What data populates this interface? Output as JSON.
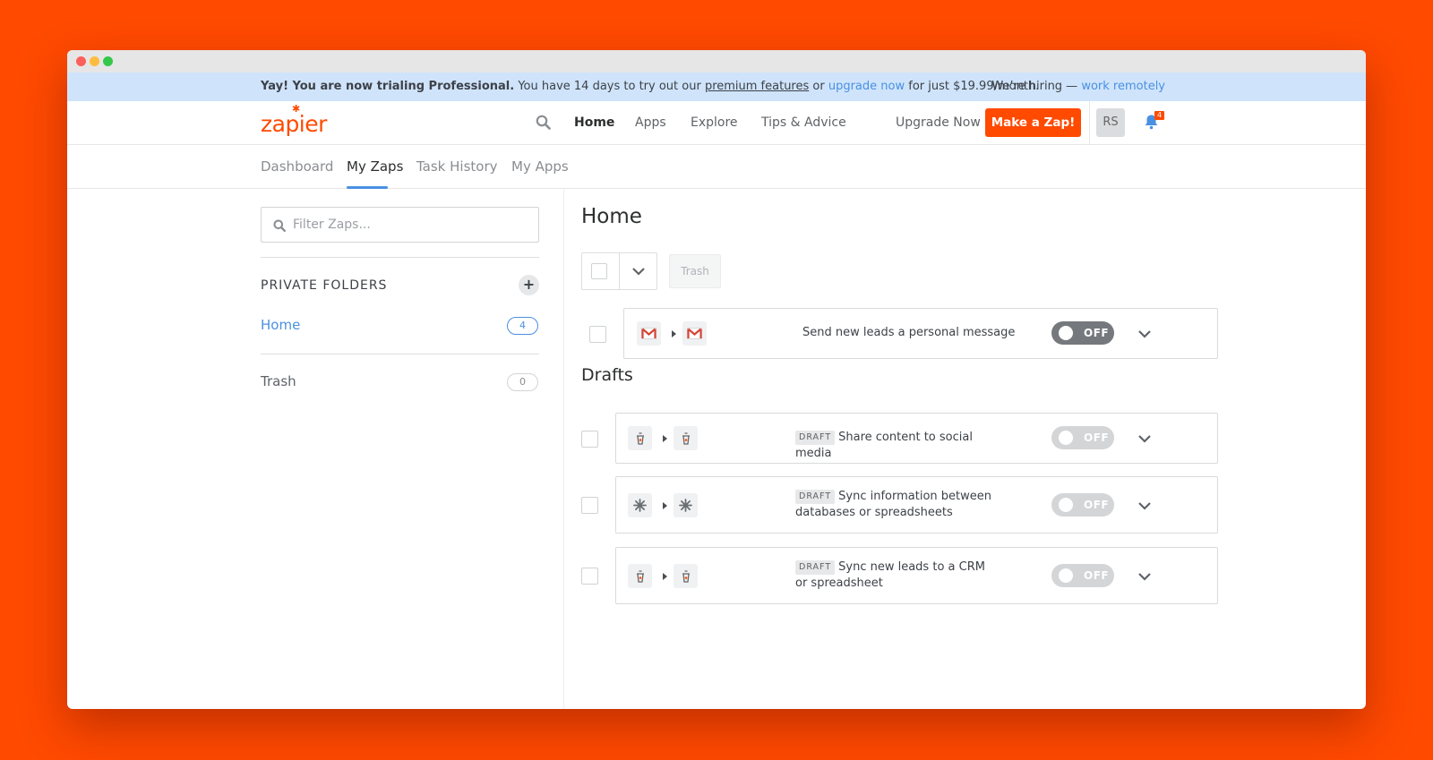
{
  "banner": {
    "bold": "Yay! You are now trialing Professional.",
    "text1": " You have 14 days to try out our ",
    "link1": "premium features",
    "text2": " or ",
    "link2": "upgrade now",
    "text3": " for just $19.99/month.",
    "hiring": "We’re hiring — ",
    "hiring_link": "work remotely"
  },
  "nav": {
    "logo": "zapier",
    "links": [
      "Home",
      "Apps",
      "Explore",
      "Tips & Advice"
    ],
    "upgrade": "Upgrade Now",
    "make_zap": "Make a Zap!",
    "avatar": "RS",
    "notification_count": "4"
  },
  "subnav": {
    "tabs": [
      "Dashboard",
      "My Zaps",
      "Task History",
      "My Apps"
    ],
    "active": "My Zaps"
  },
  "sidebar": {
    "filter_placeholder": "Filter Zaps...",
    "folders_title": "PRIVATE FOLDERS",
    "folders": [
      {
        "name": "Home",
        "count": "4"
      },
      {
        "name": "Trash",
        "count": "0"
      }
    ]
  },
  "main": {
    "title": "Home",
    "trash_button": "Trash",
    "drafts_title": "Drafts",
    "zaps": [
      {
        "title": "Send new leads a personal message",
        "draft": false,
        "toggle": "OFF",
        "icon": "gmail-icon"
      }
    ],
    "drafts": [
      {
        "tag": "DRAFT",
        "title": "Share content to social media",
        "toggle": "OFF",
        "icon": "webhook-icon"
      },
      {
        "tag": "DRAFT",
        "title": "Sync information between databases or spreadsheets",
        "toggle": "OFF",
        "icon": "asterisk-icon"
      },
      {
        "tag": "DRAFT",
        "title": "Sync new leads to a CRM or spreadsheet",
        "toggle": "OFF",
        "icon": "webhook-icon"
      }
    ]
  },
  "colors": {
    "background": "#ff4a00",
    "accent": "#4a90e2",
    "brand": "#ff4a00"
  }
}
